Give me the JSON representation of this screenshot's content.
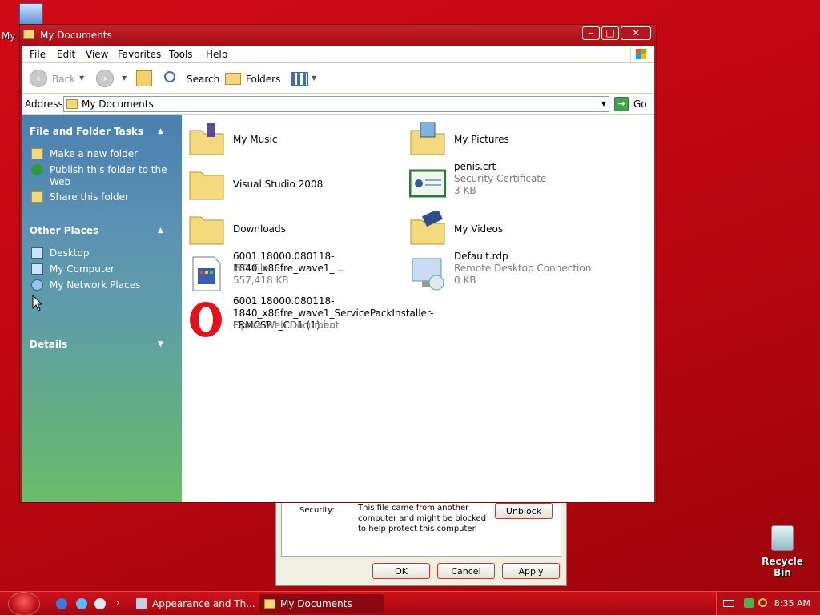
{
  "desktop": {
    "icon_my": "My",
    "recycle_bin": "Recycle Bin"
  },
  "dialog": {
    "security_label": "Security:",
    "security_text": "This file came from another computer and might be blocked to help protect this computer.",
    "unblock": "Unblock",
    "ok": "OK",
    "cancel": "Cancel",
    "apply": "Apply"
  },
  "window": {
    "title": "My Documents",
    "menu": [
      "File",
      "Edit",
      "View",
      "Favorites",
      "Tools",
      "Help"
    ],
    "toolbar": {
      "back": "Back",
      "search": "Search",
      "folders": "Folders"
    },
    "address": {
      "label": "Address",
      "value": "My Documents",
      "go": "Go"
    }
  },
  "leftpane": {
    "tasks_title": "File and Folder Tasks",
    "tasks": [
      "Make a new folder",
      "Publish this folder to the Web",
      "Share this folder"
    ],
    "places_title": "Other Places",
    "places": [
      "Desktop",
      "My Computer",
      "My Network Places"
    ],
    "details_title": "Details"
  },
  "files": [
    {
      "name": "My Music"
    },
    {
      "name": "My Pictures"
    },
    {
      "name": "Visual Studio 2008"
    },
    {
      "name": "penis.crt",
      "type": "Security Certificate",
      "size": "3 KB"
    },
    {
      "name": "Downloads"
    },
    {
      "name": "My Videos"
    },
    {
      "name": "6001.18000.080118-1840_x86fre_wave1_...",
      "type": "ISO File",
      "size": "557,418 KB"
    },
    {
      "name": "Default.rdp",
      "type": "Remote Desktop Connection",
      "size": "0 KB"
    },
    {
      "name": "6001.18000.080118-1840_x86fre_wave1_ServicePackInstaller-FRMCSP1_CD1 (1).i...",
      "type": "Opera Web Document"
    }
  ],
  "taskbar": {
    "task1": "Appearance and Th...",
    "task2": "My Documents",
    "clock": "8:35 AM"
  },
  "colors": {
    "desktop": "#c00a14",
    "pane_top": "#4b7fb0",
    "pane_bottom": "#6cbc6b"
  }
}
